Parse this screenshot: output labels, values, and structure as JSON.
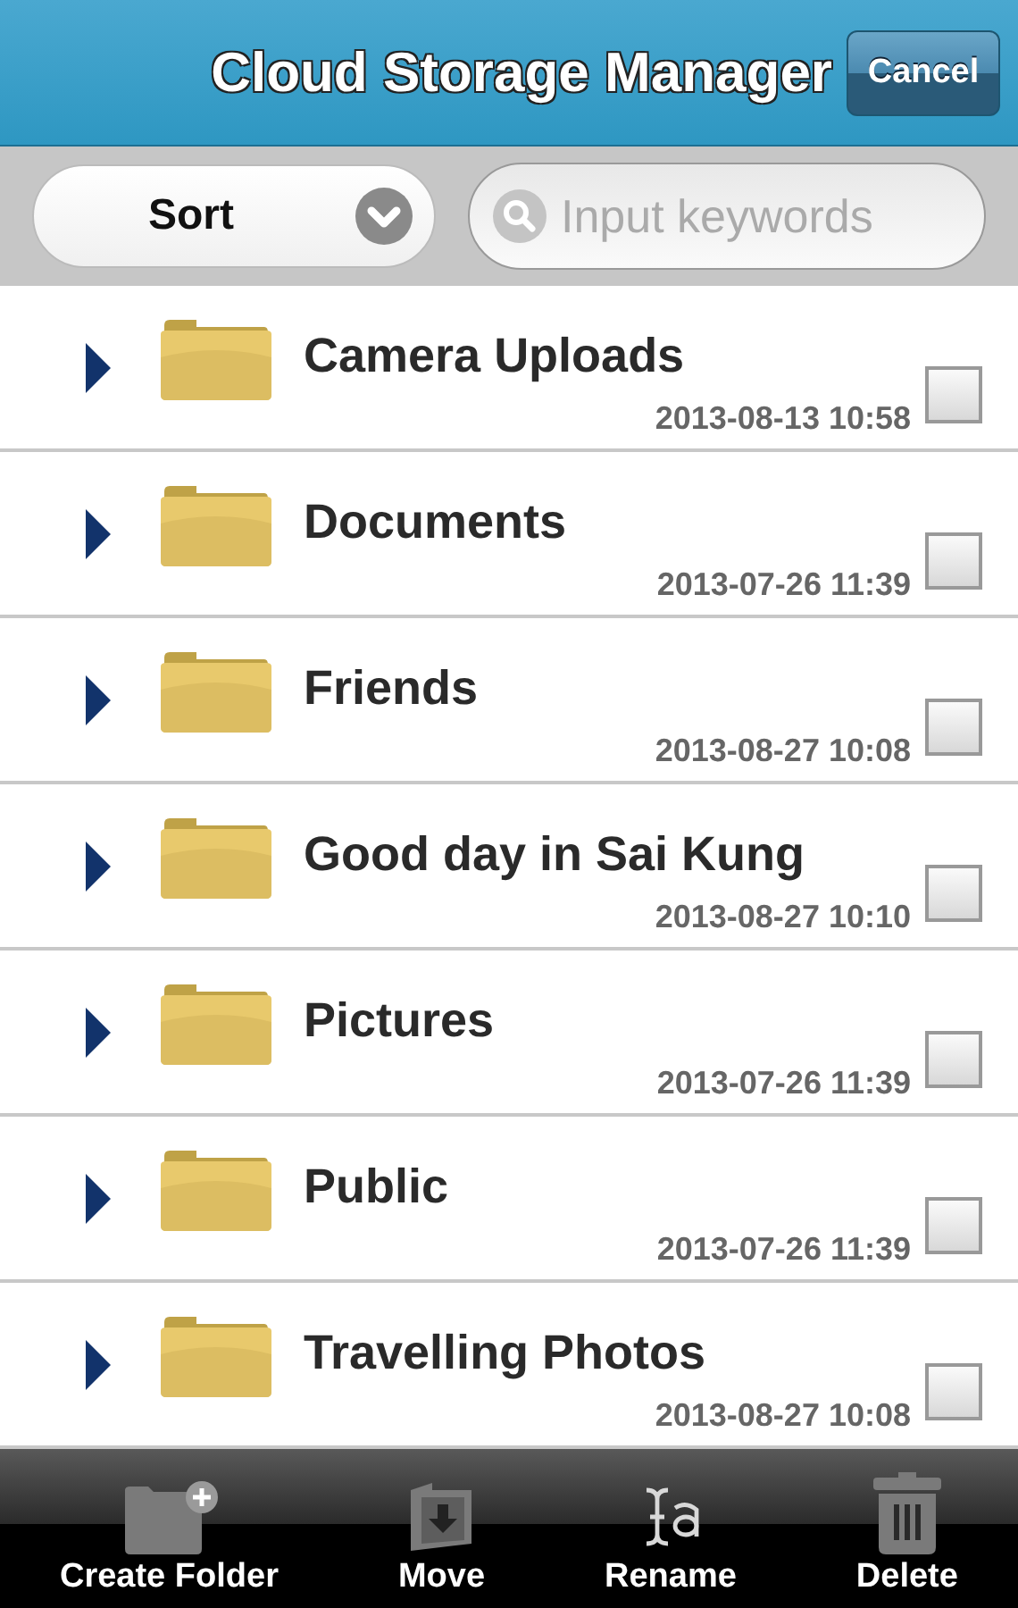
{
  "header": {
    "title": "Cloud Storage Manager",
    "cancel": "Cancel"
  },
  "toolbar": {
    "sort": "Sort",
    "search": {
      "placeholder": "Input keywords"
    }
  },
  "folders": [
    {
      "name": "Camera Uploads",
      "date": "2013-08-13 10:58",
      "checked": false
    },
    {
      "name": "Documents",
      "date": "2013-07-26 11:39",
      "checked": false
    },
    {
      "name": "Friends",
      "date": "2013-08-27 10:08",
      "checked": false
    },
    {
      "name": "Good day in Sai Kung",
      "date": "2013-08-27 10:10",
      "checked": false
    },
    {
      "name": "Pictures",
      "date": "2013-07-26 11:39",
      "checked": false
    },
    {
      "name": "Public",
      "date": "2013-07-26 11:39",
      "checked": false
    },
    {
      "name": "Travelling Photos",
      "date": "2013-08-27 10:08",
      "checked": false
    }
  ],
  "actions": [
    {
      "kind": "create",
      "label": "Create Folder"
    },
    {
      "kind": "move",
      "label": "Move"
    },
    {
      "kind": "rename",
      "label": "Rename"
    },
    {
      "kind": "delete",
      "label": "Delete"
    }
  ]
}
